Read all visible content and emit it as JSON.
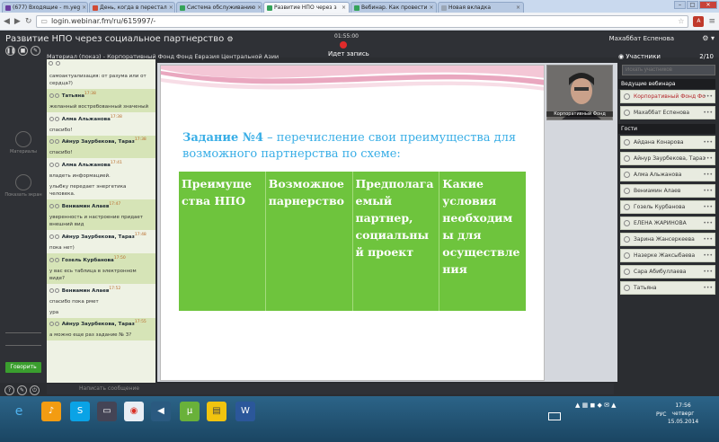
{
  "browser": {
    "tabs": [
      {
        "label": "(677) Входящие - m.yeg",
        "color": "#6a3fa0",
        "active": false
      },
      {
        "label": "День, когда в перестал",
        "color": "#d14a34",
        "active": false
      },
      {
        "label": "Система обслуживанию",
        "color": "#35a35a",
        "active": false
      },
      {
        "label": "Развитие НПО через з",
        "color": "#35a35a",
        "active": true
      },
      {
        "label": "Вебинар. Как провести",
        "color": "#35a35a",
        "active": false
      },
      {
        "label": "Новая вкладка",
        "color": "#9aa6b5",
        "active": false
      }
    ],
    "url": "login.webinar.fm/ru/615997/-"
  },
  "webinar": {
    "title": "Развитие НПО через социальное партнерство",
    "timer": "01:55:00",
    "recording_label": "Идет запись",
    "user_name": "Махаббат Еспенова",
    "material_label": "Материал (показ) - Корпоративный Фонд Фонд Евразия Центральной Азии",
    "chat_placeholder": "Написать сообщение"
  },
  "left_toolbar": {
    "materials_label": "Материалы",
    "show_screen_label": "Показать экран",
    "speak_label": "Говорить"
  },
  "chat": [
    {
      "type": "text",
      "text": "самоактуализация: от разума или от сердца?)",
      "hl": false
    },
    {
      "type": "author",
      "author": "Татьяна",
      "time": "17:38",
      "hl": true
    },
    {
      "type": "text",
      "text": "желанный востребованный значеный",
      "hl": true
    },
    {
      "type": "author",
      "author": "Алма Альжанова",
      "time": "17:38",
      "hl": false
    },
    {
      "type": "text",
      "text": "спасибо!",
      "hl": false
    },
    {
      "type": "author",
      "author": "Айнур Заурбекова, Тараз",
      "time": "17:38",
      "hl": true
    },
    {
      "type": "text",
      "text": "спасибо!",
      "hl": true
    },
    {
      "type": "author",
      "author": "Алма Альжанова",
      "time": "17:41",
      "hl": false
    },
    {
      "type": "text",
      "text": "владеть информацией.",
      "hl": false
    },
    {
      "type": "text",
      "text": "улыбку передает энергетика человека.",
      "hl": false
    },
    {
      "type": "author",
      "author": "Вениамин Алаев",
      "time": "17:47",
      "hl": true
    },
    {
      "type": "text",
      "text": "уверенность и настроение придает внешний вид",
      "hl": true
    },
    {
      "type": "author",
      "author": "Айнур Заурбекова, Тараз",
      "time": "17:48",
      "hl": false
    },
    {
      "type": "text",
      "text": "пока нет)",
      "hl": false
    },
    {
      "type": "author",
      "author": "Гозель Курбанова",
      "time": "17:50",
      "hl": true
    },
    {
      "type": "text",
      "text": "у вас есь таблица в электронном виде?",
      "hl": true
    },
    {
      "type": "author",
      "author": "Вениамин Алаев",
      "time": "17:52",
      "hl": false
    },
    {
      "type": "text",
      "text": "спасибо пока рмет",
      "hl": false
    },
    {
      "type": "text",
      "text": "ура",
      "hl": false
    },
    {
      "type": "author",
      "author": "Айнур Заурбекова, Тараз",
      "time": "17:55",
      "hl": true
    },
    {
      "type": "text",
      "text": "а можно еще раз задание № 3?",
      "hl": true
    }
  ],
  "slide": {
    "title_bold": "Задание №4",
    "title_rest": " – перечисление свои преимущества для возможного партнерства по схеме:",
    "columns": [
      "Преимуще ства НПО",
      "Возможное парнерство",
      "Предполага емый партнер, социальны й проект",
      "Какие условия необходим ы для осуществле ния"
    ]
  },
  "camera_label": "Корпоративный Фонд",
  "participants": {
    "title": "Участники",
    "count": "2/10",
    "search_placeholder": "Искать участников",
    "hosts_label": "Ведущие вебинара",
    "guests_label": "Гости",
    "hosts": [
      "Корпоративный Фонд Фо",
      "Махаббат Еспенова"
    ],
    "guests": [
      "Айдана Конарова",
      "Айнур Заурбекова, Тараз",
      "Алма Альжанова",
      "Вениамин Алаев",
      "Гозель Курбанова",
      "ЕЛЕНА ЖАРИНОВА",
      "Зарина Жансеркеева",
      "Назерке Жаксыбаева",
      "Сара Абибуллаева",
      "Татьяна"
    ]
  },
  "taskbar": {
    "time": "17:56",
    "day": "четверг",
    "date": "15.05.2014",
    "lang": "РУС"
  }
}
